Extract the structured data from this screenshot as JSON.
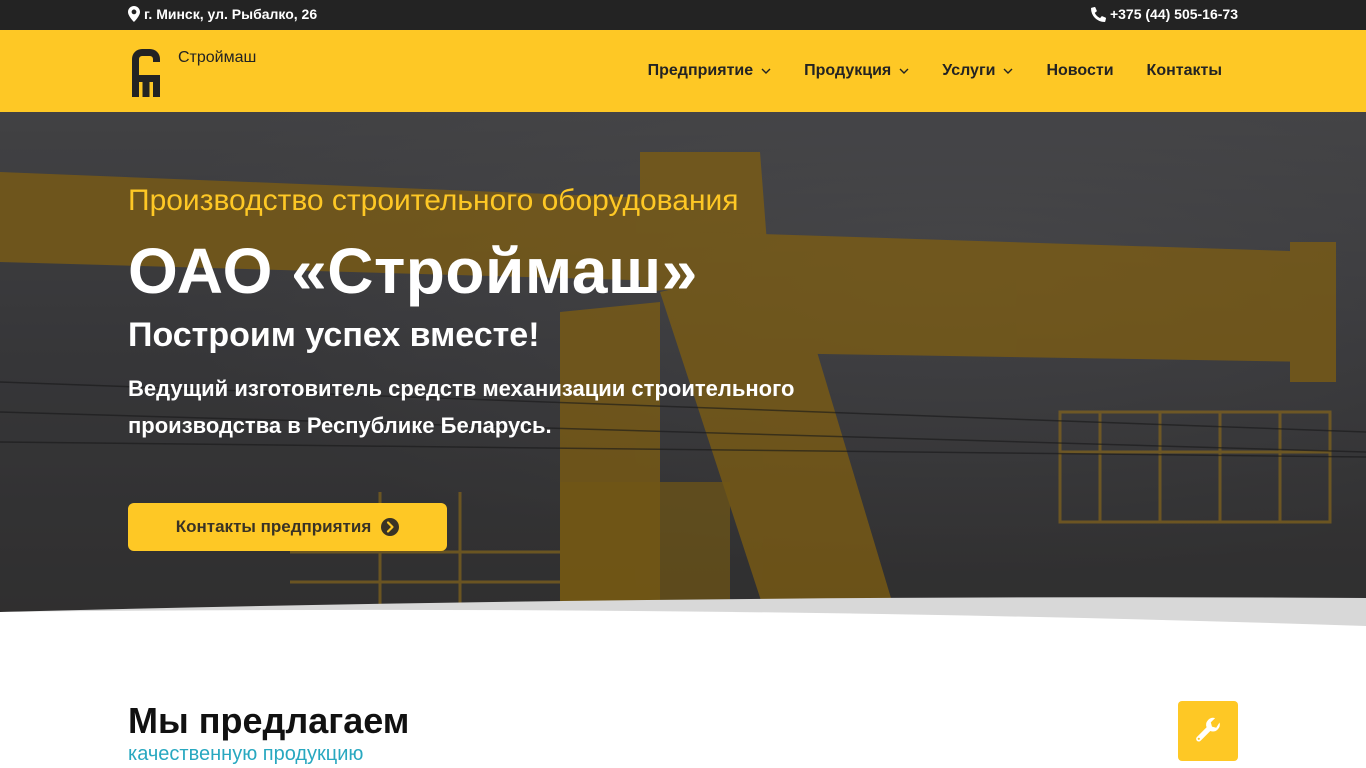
{
  "topbar": {
    "address": "г. Минск, ул. Рыбалко, 26",
    "address_icon": "map-marker-icon",
    "phone": "+375 (44) 505-16-73",
    "phone_icon": "phone-icon"
  },
  "header": {
    "logo_text": "Строймаш",
    "nav": [
      {
        "label": "Предприятие",
        "has_dropdown": true
      },
      {
        "label": "Продукция",
        "has_dropdown": true
      },
      {
        "label": "Услуги",
        "has_dropdown": true
      },
      {
        "label": "Новости",
        "has_dropdown": false
      },
      {
        "label": "Контакты",
        "has_dropdown": false
      }
    ]
  },
  "hero": {
    "subtitle": "Производство строительного оборудования",
    "title": "ОАО «Строймаш»",
    "slogan": "Построим успех вместе!",
    "description": "Ведущий изготовитель средств механизации строительного производства в Республике Беларусь.",
    "button_label": "Контакты предприятия",
    "button_icon": "arrow-circle-right-icon"
  },
  "offer": {
    "title": "Мы предлагаем",
    "subtitle": "качественную продукцию",
    "icon": "wrench-icon"
  },
  "colors": {
    "accent": "#fec825",
    "topbar": "#232323",
    "subtitle_link": "#28a8c0"
  }
}
